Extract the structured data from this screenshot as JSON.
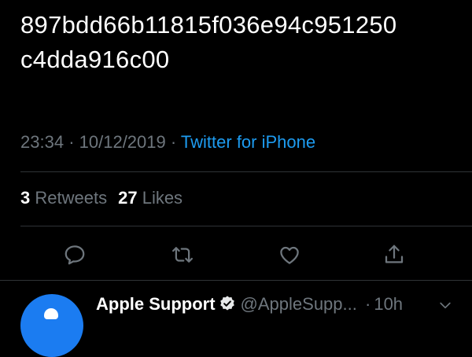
{
  "tweet": {
    "text_lines": [
      "897bdd66b11815f036e94c951250",
      "c4dda916c00"
    ],
    "time": "23:34",
    "date": "10/12/2019",
    "separator": "·",
    "source": "Twitter for iPhone"
  },
  "stats": {
    "retweets_count": "3",
    "retweets_label": "Retweets",
    "likes_count": "27",
    "likes_label": "Likes"
  },
  "actions": {
    "icons": [
      "reply-icon",
      "retweet-icon",
      "like-icon",
      "share-icon"
    ]
  },
  "reply": {
    "avatar_icon": "apple-logo-icon",
    "name": "Apple Support",
    "verified_icon": "verified-badge-icon",
    "handle": "@AppleSupp...",
    "dot": "·",
    "age": "10h",
    "menu_icon": "chevron-down-icon"
  },
  "colors": {
    "background": "#000000",
    "text": "#ffffff",
    "muted": "#6e767d",
    "link": "#1d9bf0",
    "divider": "#2f3336",
    "avatar": "#1b7cf1"
  }
}
